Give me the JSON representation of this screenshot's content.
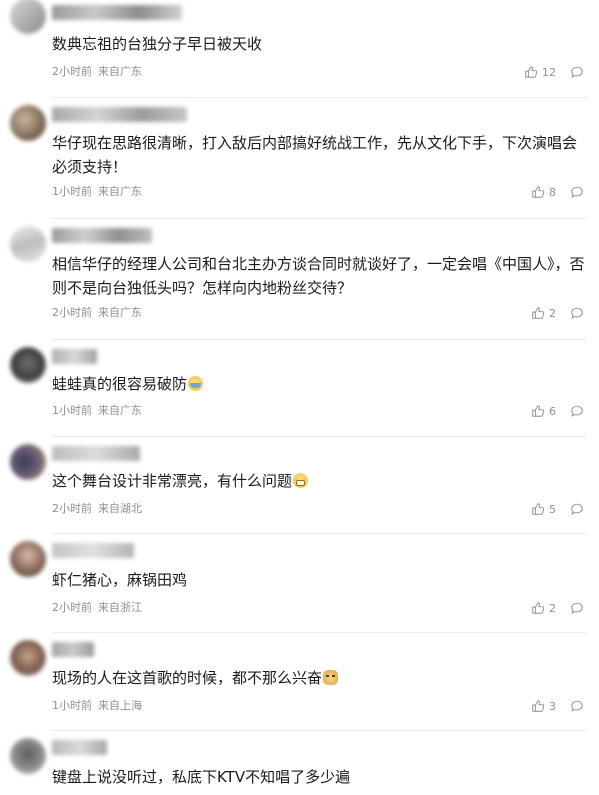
{
  "comments": [
    {
      "text": "数典忘祖的台独分子早日被天收",
      "time": "2小时前",
      "location": "来自广东",
      "likes": "12"
    },
    {
      "text": "华仔现在思路很清晰，打入敌后内部搞好统战工作，先从文化下手，下次演唱会必须支持！",
      "time": "1小时前",
      "location": "来自广东",
      "likes": "8"
    },
    {
      "text": "相信华仔的经理人公司和台北主办方谈合同时就谈好了，一定会唱《中国人》，否则不是向台独低头吗？怎样向内地粉丝交待？",
      "time": "2小时前",
      "location": "来自广东",
      "likes": "2"
    },
    {
      "text": "蛙蛙真的很容易破防",
      "time": "1小时前",
      "location": "来自广东",
      "likes": "6",
      "emoji": "teary-face-emoji"
    },
    {
      "text": "这个舞台设计非常漂亮，有什么问题",
      "time": "2小时前",
      "location": "来自湖北",
      "likes": "5",
      "emoji": "grinning-face-emoji"
    },
    {
      "text": "虾仁猪心，麻锅田鸡",
      "time": "2小时前",
      "location": "来自浙江",
      "likes": "2"
    },
    {
      "text": "现场的人在这首歌的时候，都不那么兴奋",
      "time": "1小时前",
      "location": "来自上海",
      "likes": "3",
      "emoji": "doge-emoji"
    },
    {
      "text": "键盘上说没听过，私底下KTV不知唱了多少遍"
    }
  ]
}
